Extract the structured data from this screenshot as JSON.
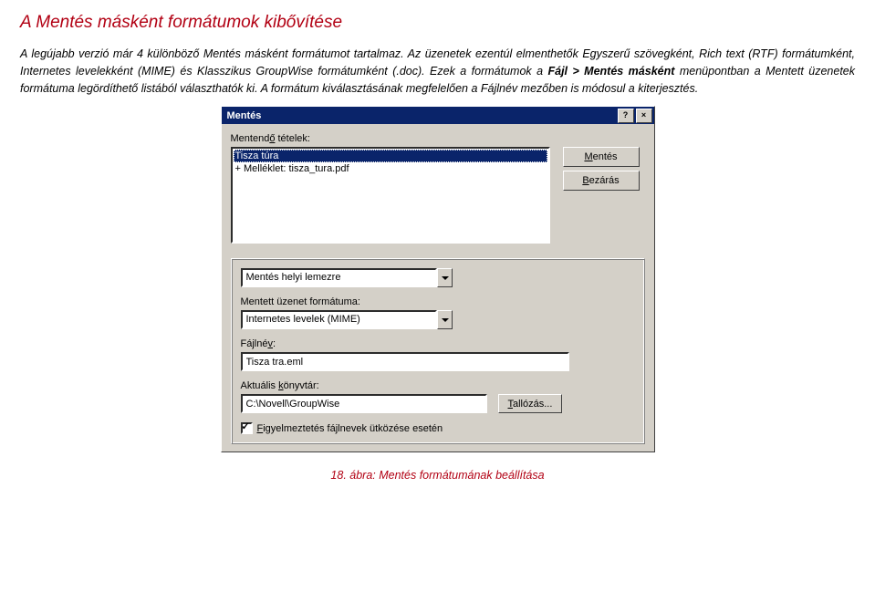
{
  "heading": "A Mentés másként formátumok kibővítése",
  "para1": "A legújabb verzió már 4 különböző Mentés másként formátumot tartalmaz. Az üzenetek ezentúl elmenthetők Egyszerű szövegként, Rich text (RTF) formátumként, Internetes levelekként (MIME) és Klasszikus GroupWise formátumként (.doc). Ezek a formátumok a ",
  "menupath": "Fájl > Mentés másként",
  "para2a": " menüpontban a ",
  "italic2": "Mentett üzenetek formátuma",
  "para2b": " legördíthető listából választhatók ki. A formátum kiválasztásának megfelelően a ",
  "italic3": "Fájlnév",
  "para2c": " mezőben is módosul a kiterjesztés.",
  "dialog": {
    "title": "Mentés",
    "help": "?",
    "close": "×",
    "items_label_pre": "Mentend",
    "items_label_u": "ő",
    "items_label_post": " tételek:",
    "list_selected": "Tisza túra",
    "list_item2": "  + Melléklet: tisza_tura.pdf",
    "btn_save_pre": "",
    "btn_save_u": "M",
    "btn_save_post": "entés",
    "btn_close_pre": "",
    "btn_close_u": "B",
    "btn_close_post": "ezárás",
    "f1_label": "Mentés helyi lemezre",
    "f2_label": "Mentett üzenet formátuma:",
    "f2_value": "Internetes levelek (MIME)",
    "f3_label": "Fájlné",
    "f3_label_u": "v",
    "f3_label_post": ":",
    "f3_value": "Tisza tra.eml",
    "f4_label_pre": "Aktuális ",
    "f4_label_u": "k",
    "f4_label_post": "önyvtár:",
    "f4_value": "C:\\Novell\\GroupWise",
    "browse_pre": "",
    "browse_u": "T",
    "browse_post": "allózás...",
    "chk_pre": "",
    "chk_u": "F",
    "chk_post": "igyelmeztetés fájlnevek ütközése esetén"
  },
  "caption": "18. ábra: Mentés formátumának beállítása"
}
